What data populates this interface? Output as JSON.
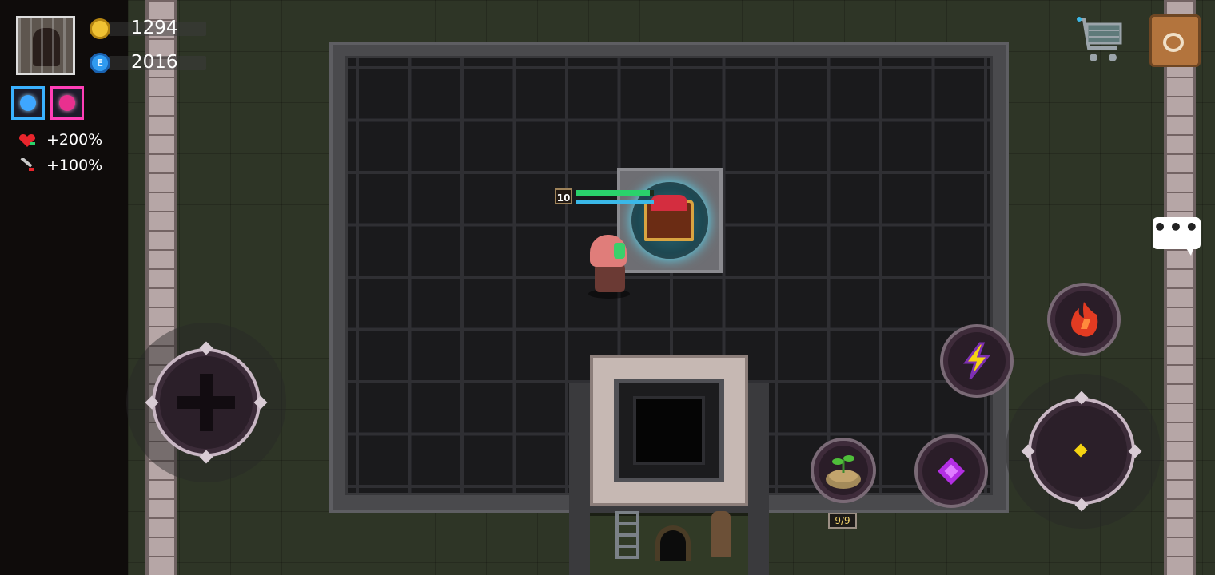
{
  "hud": {
    "gold": "1294",
    "gems": "2016",
    "gem_symbol": "E",
    "stats": [
      {
        "icon": "heart-icon",
        "value": "+200%"
      },
      {
        "icon": "sword-icon",
        "value": "+100%"
      }
    ],
    "buffs": [
      {
        "icon": "blue-orb-buff-icon",
        "color": "#3ab1ff"
      },
      {
        "icon": "pink-skull-buff-icon",
        "color": "#ff3fb7"
      }
    ]
  },
  "player": {
    "level": "10",
    "hp_fraction": 0.95,
    "mp_fraction": 1.0
  },
  "inventory": {
    "item_count": "9/9"
  },
  "controls": {
    "top_right": [
      "shopping-cart-icon",
      "backpack-icon"
    ],
    "chat": "chat-bubble-icon",
    "skills": [
      "lightning-skill-icon",
      "fire-skill-icon",
      "purple-gem-skill-icon",
      "sprout-pot-item-icon"
    ]
  },
  "colors": {
    "gold": "#f0c233",
    "gem": "#2f9bf0",
    "hp": "#2ad26b",
    "mp": "#3ab8e8",
    "lightning": "#f5d311",
    "fire": "#e23b22",
    "purple": "#b32ee3"
  }
}
